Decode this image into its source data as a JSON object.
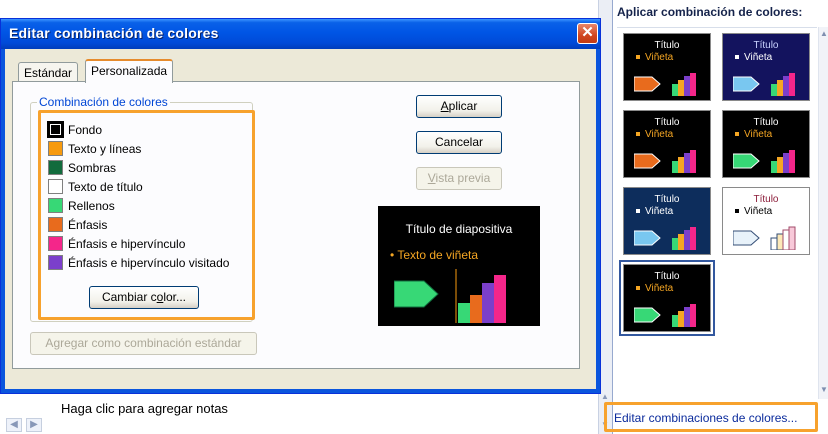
{
  "dialog": {
    "title": "Editar combinación de colores",
    "close_glyph": "✕",
    "tabs": [
      {
        "label": "Estándar",
        "active": false
      },
      {
        "label": "Personalizada",
        "active": true
      }
    ],
    "group_label": "Combinación de colores",
    "color_items": [
      {
        "label": "Fondo",
        "color": "#000000",
        "selected": true
      },
      {
        "label": "Texto y líneas",
        "color": "#f79a0e",
        "selected": false
      },
      {
        "label": "Sombras",
        "color": "#116b3d",
        "selected": false
      },
      {
        "label": "Texto de título",
        "color": "#ffffff",
        "selected": false
      },
      {
        "label": "Rellenos",
        "color": "#37d876",
        "selected": false
      },
      {
        "label": "Énfasis",
        "color": "#e86b1d",
        "selected": false
      },
      {
        "label": "Énfasis e hipervínculo",
        "color": "#f4268a",
        "selected": false
      },
      {
        "label": "Énfasis e hipervínculo visitado",
        "color": "#7b3fcb",
        "selected": false
      }
    ],
    "change_color_button": {
      "before": "Cambiar c",
      "accel": "o",
      "after": "lor..."
    },
    "add_standard_button": {
      "before": "A",
      "accel": "g",
      "after": "regar como combinación estándar"
    },
    "apply_button": {
      "before": "",
      "accel": "A",
      "after": "plicar"
    },
    "cancel_button": "Cancelar",
    "preview_button": {
      "before": "",
      "accel": "V",
      "after": "ista previa"
    },
    "preview": {
      "title": "Título de diapositiva",
      "bullet": "• Texto de viñeta"
    }
  },
  "notes": {
    "placeholder": "Haga clic para agregar notas"
  },
  "taskpane": {
    "title": "Aplicar combinación de colores:",
    "thumb_title": "Título",
    "thumb_bullet": "Viñeta",
    "schemes": [
      {
        "bg": "#000000",
        "title_color": "#ffffff",
        "bullet_color": "#f5a623",
        "selected": false
      },
      {
        "bg": "#13135e",
        "title_color": "#c9d2ff",
        "bullet_color": "#ffffff",
        "selected": false
      },
      {
        "bg": "#000000",
        "title_color": "#ffffff",
        "bullet_color": "#f5a623",
        "selected": false
      },
      {
        "bg": "#000000",
        "title_color": "#ffffff",
        "bullet_color": "#f5a623",
        "selected": false
      },
      {
        "bg": "#0d2d5c",
        "title_color": "#ffffff",
        "bullet_color": "#ffffff",
        "selected": false
      },
      {
        "bg": "#ffffff",
        "title_color": "#8c1d3a",
        "bullet_color": "#000000",
        "selected": false
      },
      {
        "bg": "#000000",
        "title_color": "#ffffff",
        "bullet_color": "#f5a623",
        "selected": true
      }
    ],
    "edit_link": "Editar combinaciones de colores..."
  }
}
